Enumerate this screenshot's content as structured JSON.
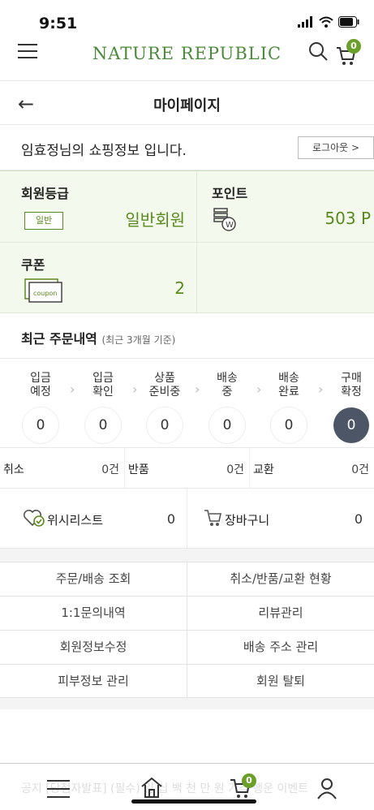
{
  "status": {
    "time": "9:51"
  },
  "header": {
    "brand": "NATURE REPUBLIC",
    "cart_badge": "0"
  },
  "titlebar": {
    "title": "마이페이지"
  },
  "greeting": {
    "text": "임효정님의 쇼핑정보 입니다.",
    "logout": "로그아웃 >"
  },
  "info": {
    "grade_label": "회원등급",
    "grade_badge": "일반",
    "grade_value": "일반회원",
    "point_label": "포인트",
    "point_value": "503 P",
    "coupon_label": "쿠폰",
    "coupon_icon_text": "coupon",
    "coupon_value": "2"
  },
  "recent": {
    "title": "최근 주문내역",
    "subtitle": "(최근 3개월 기준)"
  },
  "steps": [
    {
      "label": "입금\n예정",
      "count": "0"
    },
    {
      "label": "입금\n확인",
      "count": "0"
    },
    {
      "label": "상품\n준비중",
      "count": "0"
    },
    {
      "label": "배송\n중",
      "count": "0"
    },
    {
      "label": "배송\n완료",
      "count": "0"
    },
    {
      "label": "구매\n확정",
      "count": "0"
    }
  ],
  "claims": [
    {
      "label": "취소",
      "value": "0건"
    },
    {
      "label": "반품",
      "value": "0건"
    },
    {
      "label": "교환",
      "value": "0건"
    }
  ],
  "wishcart": {
    "wish_label": "위시리스트",
    "wish_value": "0",
    "cart_label": "장바구니",
    "cart_value": "0"
  },
  "menu": [
    [
      "주문/배송 조회",
      "취소/반품/교환 현황"
    ],
    [
      "1:1문의내역",
      "리뷰관리"
    ],
    [
      "회원정보수정",
      "배송 주소 관리"
    ],
    [
      "피부정보 관리",
      "회원 탈퇴"
    ]
  ],
  "bottom": {
    "notice": "공지 [당첨자발표] (필수) 일 십 백 천 만 원 가격 행운 이벤트",
    "cart_badge": "0"
  },
  "colors": {
    "brand": "#4a8a3a",
    "accent": "#5a8a1d",
    "active_step": "#4d5666"
  }
}
